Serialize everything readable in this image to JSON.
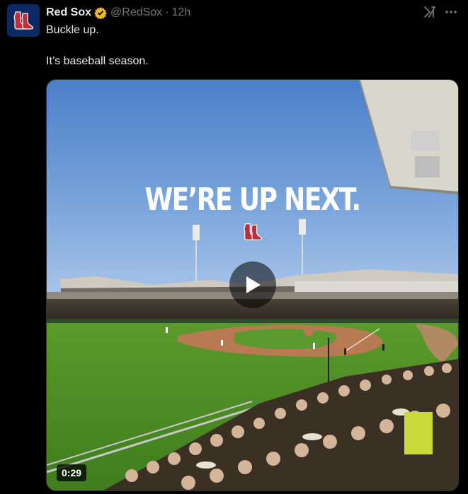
{
  "account": {
    "name": "Red Sox",
    "handle": "@RedSox",
    "separator": "·",
    "time": "12h"
  },
  "post": {
    "line1": "Buckle up.",
    "line2": "It’s baseball season."
  },
  "media": {
    "overlay_text": "WE’RE UP NEXT.",
    "duration": "0:29"
  },
  "icons": {
    "verified": "verified-badge-icon",
    "grok": "grok-icon",
    "more": "more-dots-icon",
    "play": "play-icon",
    "logo": "red-sox-logo"
  },
  "colors": {
    "background": "#000000",
    "text": "#e7e9ea",
    "muted": "#71767b",
    "verified_gold": "#e8b829",
    "brand_red": "#bd3039",
    "brand_navy": "#0b2a63"
  }
}
